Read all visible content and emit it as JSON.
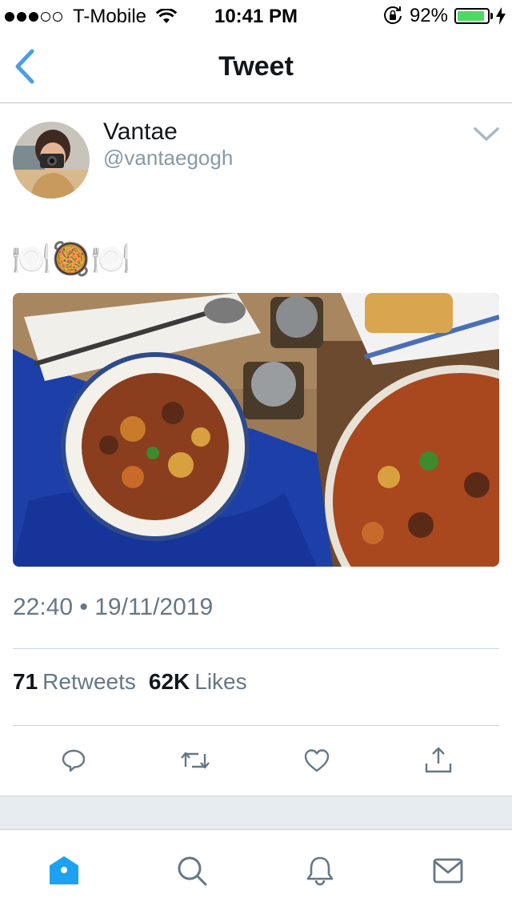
{
  "status_bar": {
    "carrier": "T-Mobile",
    "time": "10:41 PM",
    "battery_percent": "92%",
    "battery_level": 0.92,
    "signal_bars": 3,
    "signal_total": 5
  },
  "nav": {
    "title": "Tweet"
  },
  "tweet": {
    "display_name": "Vantae",
    "handle": "@vantaegogh",
    "text": "🍽️🥘🍽️",
    "timestamp": "22:40 • 19/11/2019",
    "retweets_count": "71",
    "retweets_label": "Retweets",
    "likes_count": "62K",
    "likes_label": "Likes"
  },
  "colors": {
    "accent": "#1da1f2",
    "back_arrow": "#4a9fe0",
    "secondary_text": "#657786",
    "divider": "#ccd6dd",
    "battery_green": "#4cd964"
  },
  "icons": {
    "back": "chevron-left-icon",
    "caret": "chevron-down-icon",
    "reply": "reply-icon",
    "retweet": "retweet-icon",
    "like": "heart-icon",
    "share": "share-icon",
    "home": "home-icon",
    "search": "search-icon",
    "notifications": "bell-icon",
    "messages": "mail-icon"
  }
}
